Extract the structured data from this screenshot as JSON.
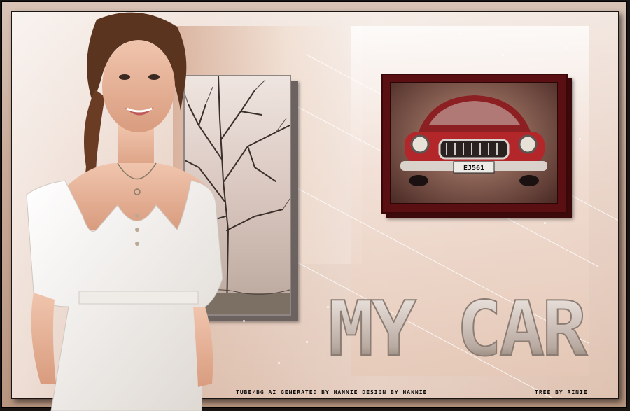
{
  "artwork": {
    "title_text": "MY CAR",
    "credit_left": "TUBE/BG AI GENERATED BY HANNIE DESIGN BY HANNIE",
    "credit_right": "TREE BY RINIE",
    "license_plate": "EJ561"
  },
  "colors": {
    "frame": "#c9aa98",
    "accent_dark_red": "#5a0f12",
    "car_red": "#b3272a",
    "dress_white": "#f7f4f0",
    "hair_brown": "#5b3420"
  }
}
